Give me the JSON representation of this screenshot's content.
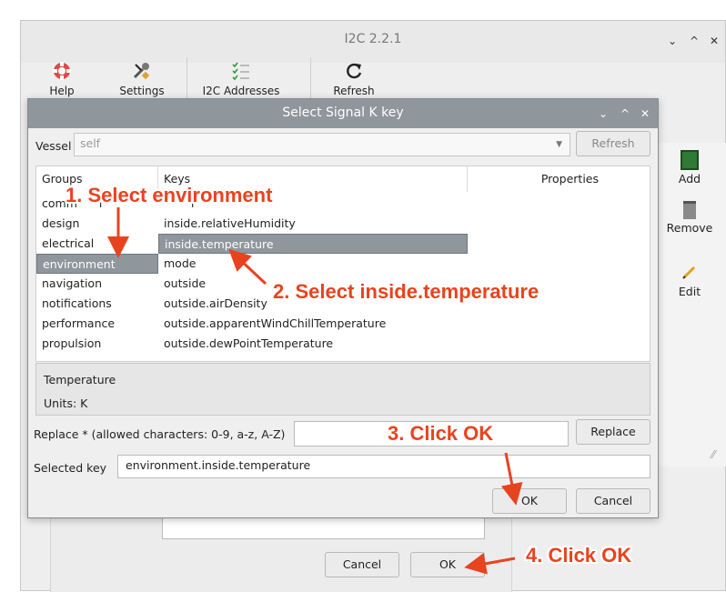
{
  "main_window": {
    "title": "I2C 2.2.1",
    "controls": [
      "⌄",
      "^",
      "✕"
    ],
    "toolbar": [
      {
        "label": "Help",
        "icon": "lifebuoy-icon"
      },
      {
        "label": "Settings",
        "icon": "wrench-icon"
      },
      {
        "label": "I2C Addresses",
        "icon": "checklist-icon"
      },
      {
        "label": "Refresh",
        "icon": "refresh-icon"
      }
    ],
    "side_buttons": [
      {
        "label": "Add",
        "icon": "add-device-icon"
      },
      {
        "label": "Remove",
        "icon": "trash-icon"
      },
      {
        "label": "Edit",
        "icon": "pencil-icon"
      }
    ],
    "bottom_buttons": {
      "cancel": "Cancel",
      "ok": "OK"
    }
  },
  "dialog": {
    "title": "Select Signal K key",
    "controls": [
      "⌄",
      "^",
      "✕"
    ],
    "vessel_label": "Vessel",
    "vessel_value": "self",
    "refresh_label": "Refresh",
    "columns": {
      "groups": "Groups",
      "keys": "Keys",
      "properties": "Properties"
    },
    "groups": [
      "comm",
      "design",
      "electrical",
      "environment",
      "navigation",
      "notifications",
      "performance",
      "propulsion"
    ],
    "groups_first_suffix": "i",
    "selected_group": "environment",
    "keys": [
      "inside.relativeHumidity",
      "inside.temperature",
      "mode",
      "outside",
      "outside.airDensity",
      "outside.apparentWindChillTemperature",
      "outside.dewPointTemperature"
    ],
    "keys_partial_first": "r",
    "selected_key": "inside.temperature",
    "description_title": "Temperature",
    "description_units": "Units: K",
    "replace_label": "Replace * (allowed characters: 0-9, a-z, A-Z)",
    "replace_button": "Replace",
    "selected_key_label": "Selected key",
    "selected_key_value": "environment.inside.temperature",
    "ok_label": "OK",
    "cancel_label": "Cancel"
  },
  "annotations": {
    "step1": "1. Select environment",
    "step2": "2. Select inside.temperature",
    "step3": "3. Click OK",
    "step4": "4. Click OK",
    "color": "#e8431f"
  },
  "colors": {
    "selection": "#8f969c",
    "dialog_titlebar": "#8f969c",
    "annotation": "#e8431f"
  }
}
